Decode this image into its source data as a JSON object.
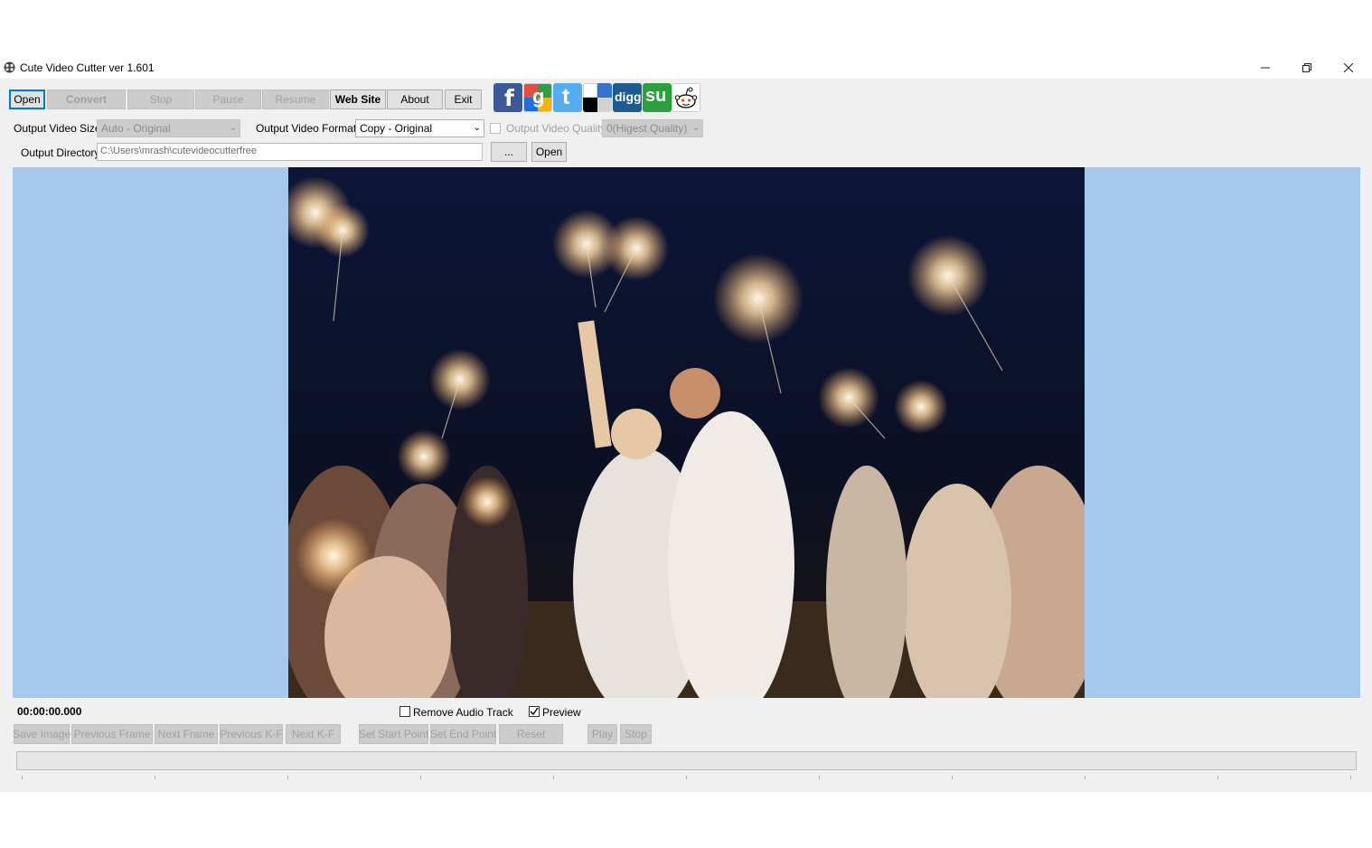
{
  "window": {
    "title": "Cute Video Cutter ver 1.601",
    "controls": [
      "minimize",
      "restore",
      "close"
    ]
  },
  "toolbar": {
    "open": "Open",
    "convert": "Convert",
    "stop": "Stop",
    "pause": "Pause",
    "resume": "Resume",
    "website": "Web Site",
    "about": "About",
    "exit": "Exit"
  },
  "social_icons": [
    "facebook-icon",
    "google-icon",
    "twitter-icon",
    "delicious-icon",
    "digg-icon",
    "stumbleupon-icon",
    "reddit-icon"
  ],
  "social_labels": {
    "facebook": "f",
    "google": "g",
    "twitter": "t",
    "digg": "digg",
    "stumbleupon": "su"
  },
  "options": {
    "size_label": "Output Video Size:",
    "size_value": "Auto - Original",
    "format_label": "Output Video Format:",
    "format_value": "Copy - Original",
    "quality_label": "Output Video Quality",
    "quality_value": "0(Higest Quality)",
    "dir_label": "Output Directory:",
    "dir_value": "C:\\Users\\mrash\\cutevideocutterfree",
    "browse": "...",
    "open_dir": "Open"
  },
  "playback": {
    "timecode": "00:00:00.000",
    "remove_audio_label": "Remove Audio Track",
    "remove_audio_checked": false,
    "preview_label": "Preview",
    "preview_checked": true,
    "buttons": {
      "save_image": "Save Image",
      "prev_frame": "Previous Frame",
      "next_frame": "Next Frame",
      "prev_kf": "Previous K-F",
      "next_kf": "Next K-F",
      "set_start": "Set  Start Point",
      "set_end": "Set  End Point",
      "reset": "Reset",
      "play": "Play",
      "stop": "Stop"
    }
  },
  "progress": 0,
  "colors": {
    "video_bg": "#a6c8ee",
    "window_bg": "#f0f0f0",
    "focus": "#0078d7"
  }
}
